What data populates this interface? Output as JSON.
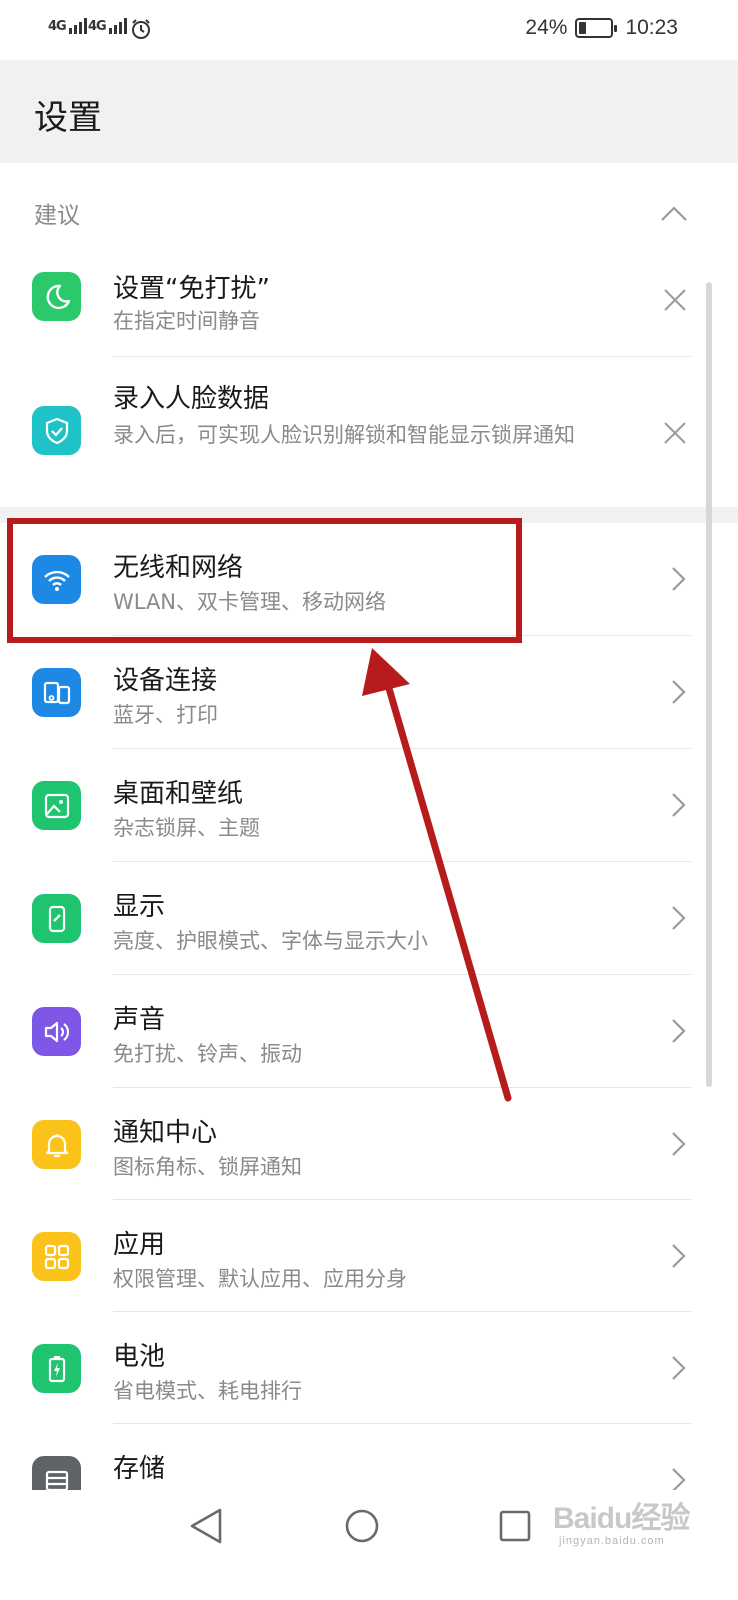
{
  "status_bar": {
    "signal_1": "4G",
    "signal_2": "4G",
    "battery_percent_text": "24%",
    "battery_level": 0.24,
    "time": "10:23",
    "icons": [
      "signal-4g-icon",
      "signal-4g-icon",
      "alarm-icon",
      "battery-icon"
    ]
  },
  "header": {
    "title": "设置"
  },
  "suggestions": {
    "label": "建议",
    "items": [
      {
        "title": "设置“免打扰”",
        "subtitle": "在指定时间静音",
        "icon": "moon-icon",
        "color": "#2bc96b"
      },
      {
        "title": "录入人脸数据",
        "subtitle": "录入后，可实现人脸识别解锁和智能显示锁屏通知",
        "icon": "shield-check-icon",
        "color": "#1fc2c7"
      }
    ]
  },
  "settings": [
    {
      "title": "无线和网络",
      "subtitle": "WLAN、双卡管理、移动网络",
      "icon": "wifi-icon",
      "color": "#1e88e5"
    },
    {
      "title": "设备连接",
      "subtitle": "蓝牙、打印",
      "icon": "device-connect-icon",
      "color": "#1e88e5"
    },
    {
      "title": "桌面和壁纸",
      "subtitle": "杂志锁屏、主题",
      "icon": "wallpaper-icon",
      "color": "#1ec46e"
    },
    {
      "title": "显示",
      "subtitle": "亮度、护眼模式、字体与显示大小",
      "icon": "display-icon",
      "color": "#1ec46e"
    },
    {
      "title": "声音",
      "subtitle": "免打扰、铃声、振动",
      "icon": "speaker-icon",
      "color": "#7e57e6"
    },
    {
      "title": "通知中心",
      "subtitle": "图标角标、锁屏通知",
      "icon": "bell-icon",
      "color": "#fbc21a"
    },
    {
      "title": "应用",
      "subtitle": "权限管理、默认应用、应用分身",
      "icon": "apps-grid-icon",
      "color": "#fbc21a"
    },
    {
      "title": "电池",
      "subtitle": "省电模式、耗电排行",
      "icon": "battery-icon",
      "color": "#1ec46e"
    },
    {
      "title": "存储",
      "subtitle": "",
      "icon": "storage-icon",
      "color": "#5f6368"
    }
  ],
  "nav": {
    "icons": [
      "back-icon",
      "home-icon",
      "recents-icon"
    ]
  },
  "watermark": {
    "main": "Baidu经验",
    "sub": "jingyan.baidu.com"
  },
  "colors": {
    "annotation": "#b71c1c",
    "background": "#f1f1f1"
  }
}
